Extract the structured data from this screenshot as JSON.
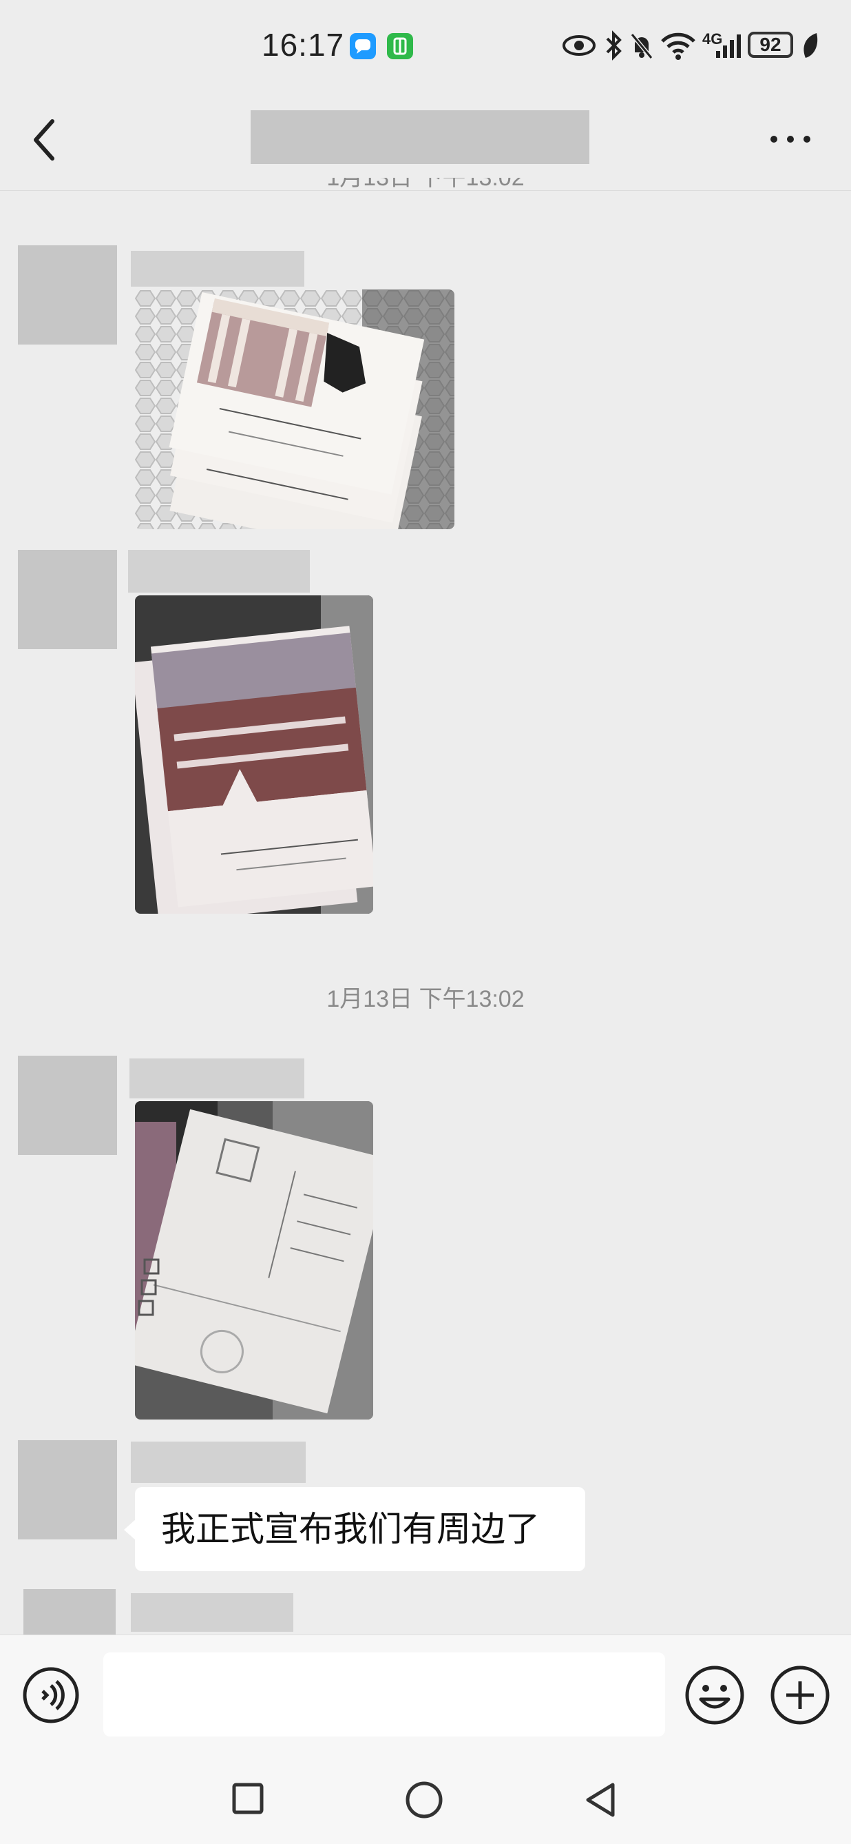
{
  "status_bar": {
    "time": "16:17",
    "battery": "92",
    "network": "4G"
  },
  "chat": {
    "timestamp_top": "1月13日 下午13:02",
    "timestamp_mid": "1月13日 下午13:02",
    "text_message": "我正式宣布我们有周边了"
  },
  "colors": {
    "background": "#ededed",
    "bubble": "#ffffff",
    "placeholder": "#c6c6c6"
  }
}
